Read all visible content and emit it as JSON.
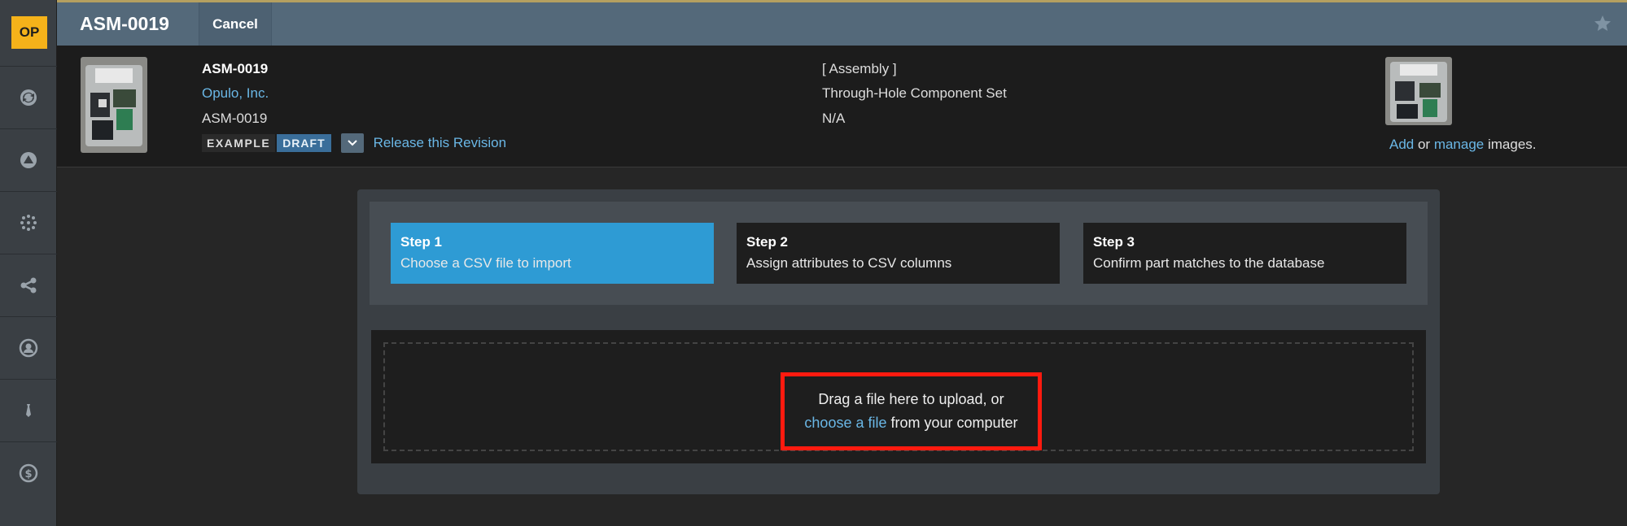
{
  "app": {
    "logo_text": "OP"
  },
  "topbar": {
    "title": "ASM-0019",
    "cancel_label": "Cancel",
    "star_icon": "star-icon"
  },
  "rail": {
    "items": [
      {
        "icon": "sync-icon"
      },
      {
        "icon": "triangle-circle-icon"
      },
      {
        "icon": "dots-grid-icon"
      },
      {
        "icon": "share-icon"
      },
      {
        "icon": "user-circle-icon"
      },
      {
        "icon": "tie-icon"
      },
      {
        "icon": "dollar-icon"
      }
    ]
  },
  "header": {
    "part_number": "ASM-0019",
    "company": "Opulo, Inc.",
    "part_number_2": "ASM-0019",
    "badge_example": "EXAMPLE",
    "badge_draft": "DRAFT",
    "release_link": "Release this Revision",
    "type": "[ Assembly ]",
    "description": "Through-Hole Component Set",
    "na": "N/A",
    "images_add": "Add",
    "images_or": " or ",
    "images_manage": "manage",
    "images_suffix": " images."
  },
  "wizard": {
    "steps": [
      {
        "title": "Step 1",
        "desc": "Choose a CSV file to import",
        "active": true
      },
      {
        "title": "Step 2",
        "desc": "Assign attributes to CSV columns",
        "active": false
      },
      {
        "title": "Step 3",
        "desc": "Confirm part matches to the database",
        "active": false
      }
    ],
    "drop_line1": "Drag a file here to upload, or",
    "drop_choose": "choose a file",
    "drop_line2_suffix": " from your computer"
  },
  "colors": {
    "accent_blue": "#2e9bd4",
    "link": "#6ab7e6",
    "highlight_red": "#ff1a0f",
    "logo_yellow": "#f5b21a"
  }
}
